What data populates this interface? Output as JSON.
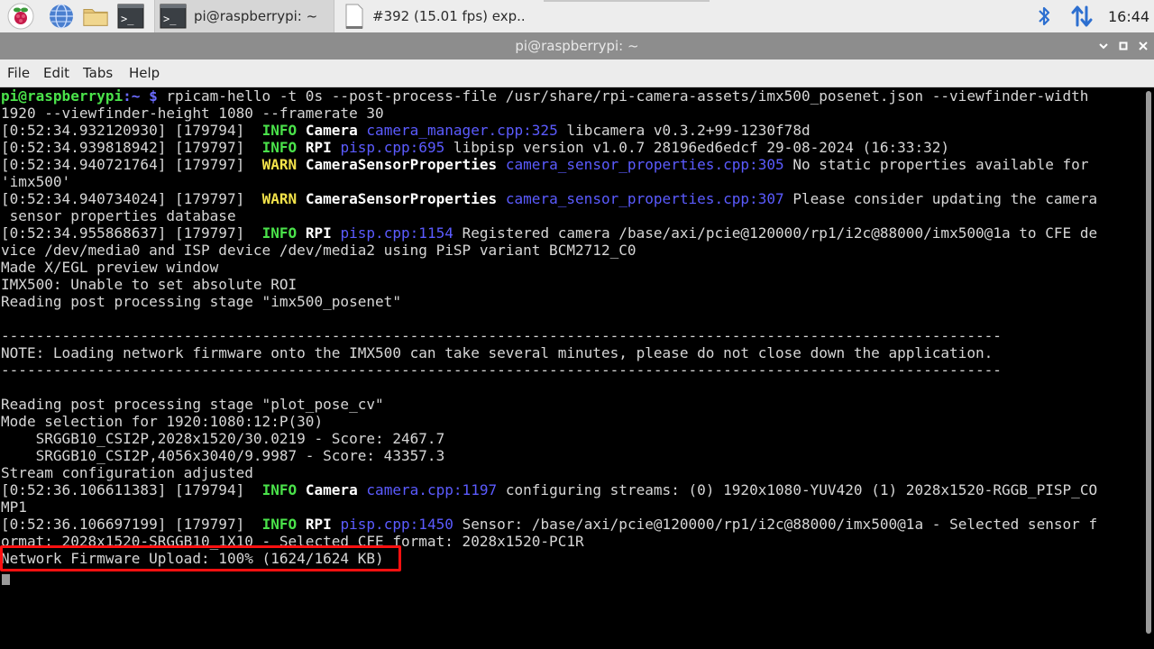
{
  "taskbar": {
    "tasks": [
      {
        "label": "pi@raspberrypi: ~"
      },
      {
        "label": "#392 (15.01 fps) exp.."
      }
    ],
    "clock": "16:44"
  },
  "window": {
    "title": "pi@raspberrypi: ~"
  },
  "menu": {
    "items": [
      "File",
      "Edit",
      "Tabs",
      "Help"
    ]
  },
  "terminal": {
    "prompt_user": "pi@raspberrypi",
    "prompt_path": ":~ $",
    "command": " rpicam-hello -t 0s --post-process-file /usr/share/rpi-camera-assets/imx500_posenet.json --viewfinder-width",
    "command_cont": "1920 --viewfinder-height 1080 --framerate 30",
    "log1": {
      "ts": "[0:52:34.932120930] [179794]  ",
      "level": "INFO",
      "cat": " Camera ",
      "src": "camera_manager.cpp:325",
      "msg": " libcamera v0.3.2+99-1230f78d"
    },
    "log2": {
      "ts": "[0:52:34.939818942] [179797]  ",
      "level": "INFO",
      "cat": " RPI ",
      "src": "pisp.cpp:695",
      "msg": " libpisp version v1.0.7 28196ed6edcf 29-08-2024 (16:33:32)"
    },
    "log3": {
      "ts": "[0:52:34.940721764] [179797]  ",
      "level": "WARN",
      "cat": " CameraSensorProperties ",
      "src": "camera_sensor_properties.cpp:305",
      "msg": " No static properties available for",
      "cont": "'imx500'"
    },
    "log4": {
      "ts": "[0:52:34.940734024] [179797]  ",
      "level": "WARN",
      "cat": " CameraSensorProperties ",
      "src": "camera_sensor_properties.cpp:307",
      "msg": " Please consider updating the camera",
      "cont": " sensor properties database"
    },
    "log5": {
      "ts": "[0:52:34.955868637] [179797]  ",
      "level": "INFO",
      "cat": " RPI ",
      "src": "pisp.cpp:1154",
      "msg": " Registered camera /base/axi/pcie@120000/rp1/i2c@88000/imx500@1a to CFE de",
      "cont": "vice /dev/media0 and ISP device /dev/media2 using PiSP variant BCM2712_C0"
    },
    "plain1": "Made X/EGL preview window",
    "plain2": "IMX500: Unable to set absolute ROI",
    "plain3": "Reading post processing stage \"imx500_posenet\"",
    "dashes": "-------------------------------------------------------------------------------------------------------------------",
    "note": "NOTE: Loading network firmware onto the IMX500 can take several minutes, please do not close down the application.",
    "plain4": "Reading post processing stage \"plot_pose_cv\"",
    "plain5": "Mode selection for 1920:1080:12:P(30)",
    "plain6": "    SRGGB10_CSI2P,2028x1520/30.0219 - Score: 2467.7",
    "plain7": "    SRGGB10_CSI2P,4056x3040/9.9987 - Score: 43357.3",
    "plain8": "Stream configuration adjusted",
    "log6": {
      "ts": "[0:52:36.106611383] [179794]  ",
      "level": "INFO",
      "cat": " Camera ",
      "src": "camera.cpp:1197",
      "msg": " configuring streams: (0) 1920x1080-YUV420 (1) 2028x1520-RGGB_PISP_CO",
      "cont": "MP1"
    },
    "log7": {
      "ts": "[0:52:36.106697199] [179797]  ",
      "level": "INFO",
      "cat": " RPI ",
      "src": "pisp.cpp:1450",
      "msg": " Sensor: /base/axi/pcie@120000/rp1/i2c@88000/imx500@1a - Selected sensor f",
      "cont": "ormat: 2028x1520-SRGGB10_1X10 - Selected CFE format: 2028x1520-PC1R"
    },
    "upload": "Network Firmware Upload: 100% (1624/1624 KB)"
  },
  "colors": {
    "highlight": "#ff1010",
    "prompt": "#4ae24a",
    "path": "#6b6bff",
    "warn": "#f2e24a",
    "link": "#5b5bff"
  },
  "icons": [
    "raspberry-pi-menu-icon",
    "web-browser-icon",
    "file-manager-icon",
    "terminal-icon",
    "bluetooth-icon",
    "network-icon"
  ]
}
